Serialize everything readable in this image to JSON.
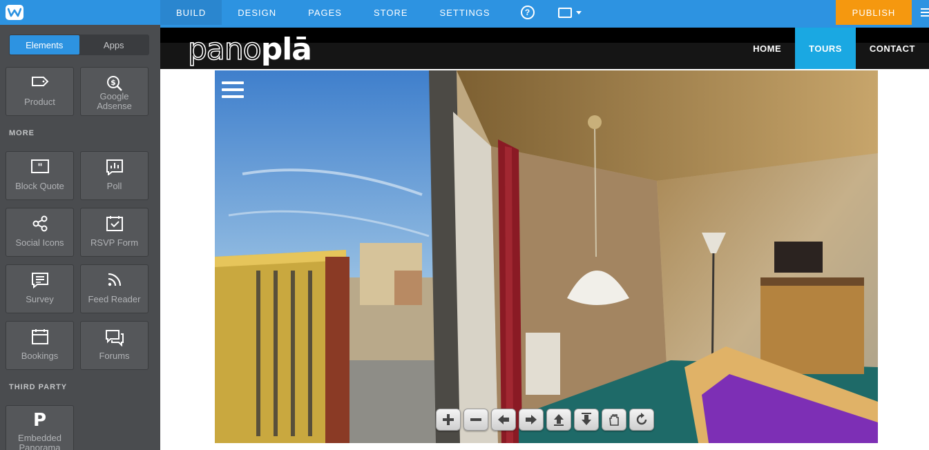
{
  "topbar": {
    "tabs": [
      {
        "label": "BUILD"
      },
      {
        "label": "DESIGN"
      },
      {
        "label": "PAGES"
      },
      {
        "label": "STORE"
      },
      {
        "label": "SETTINGS"
      }
    ],
    "help_icon": "?",
    "publish_label": "PUBLISH",
    "accent": "#2d93e1",
    "publish_color": "#f5980f"
  },
  "sidebar": {
    "segments": [
      "Elements",
      "Apps"
    ],
    "top_items": [
      {
        "label": "Product",
        "icon": "tag-icon"
      },
      {
        "label": "Google Adsense",
        "icon": "dollar-search-icon"
      }
    ],
    "more_heading": "MORE",
    "more_items": [
      {
        "label": "Block Quote",
        "icon": "quote-icon"
      },
      {
        "label": "Poll",
        "icon": "poll-icon"
      },
      {
        "label": "Social Icons",
        "icon": "share-icon"
      },
      {
        "label": "RSVP Form",
        "icon": "calendar-check-icon"
      },
      {
        "label": "Survey",
        "icon": "survey-icon"
      },
      {
        "label": "Feed Reader",
        "icon": "rss-icon"
      },
      {
        "label": "Bookings",
        "icon": "calendar-icon"
      },
      {
        "label": "Forums",
        "icon": "forum-icon"
      }
    ],
    "third_party_heading": "THIRD PARTY",
    "third_party_items": [
      {
        "label": "Embedded Panorama",
        "icon": "p-letter-icon",
        "glyph": "P"
      }
    ]
  },
  "site": {
    "brand_light": "pano",
    "brand_bold": "plā",
    "nav": [
      {
        "label": "HOME"
      },
      {
        "label": "TOURS"
      },
      {
        "label": "CONTACT"
      }
    ],
    "nav_current_color": "#1aa8e2"
  },
  "panorama": {
    "controls": [
      "zoom-in-icon",
      "zoom-out-icon",
      "arrow-left-icon",
      "arrow-right-icon",
      "arrow-up-icon",
      "arrow-down-icon",
      "hand-icon",
      "rotate-icon"
    ]
  }
}
